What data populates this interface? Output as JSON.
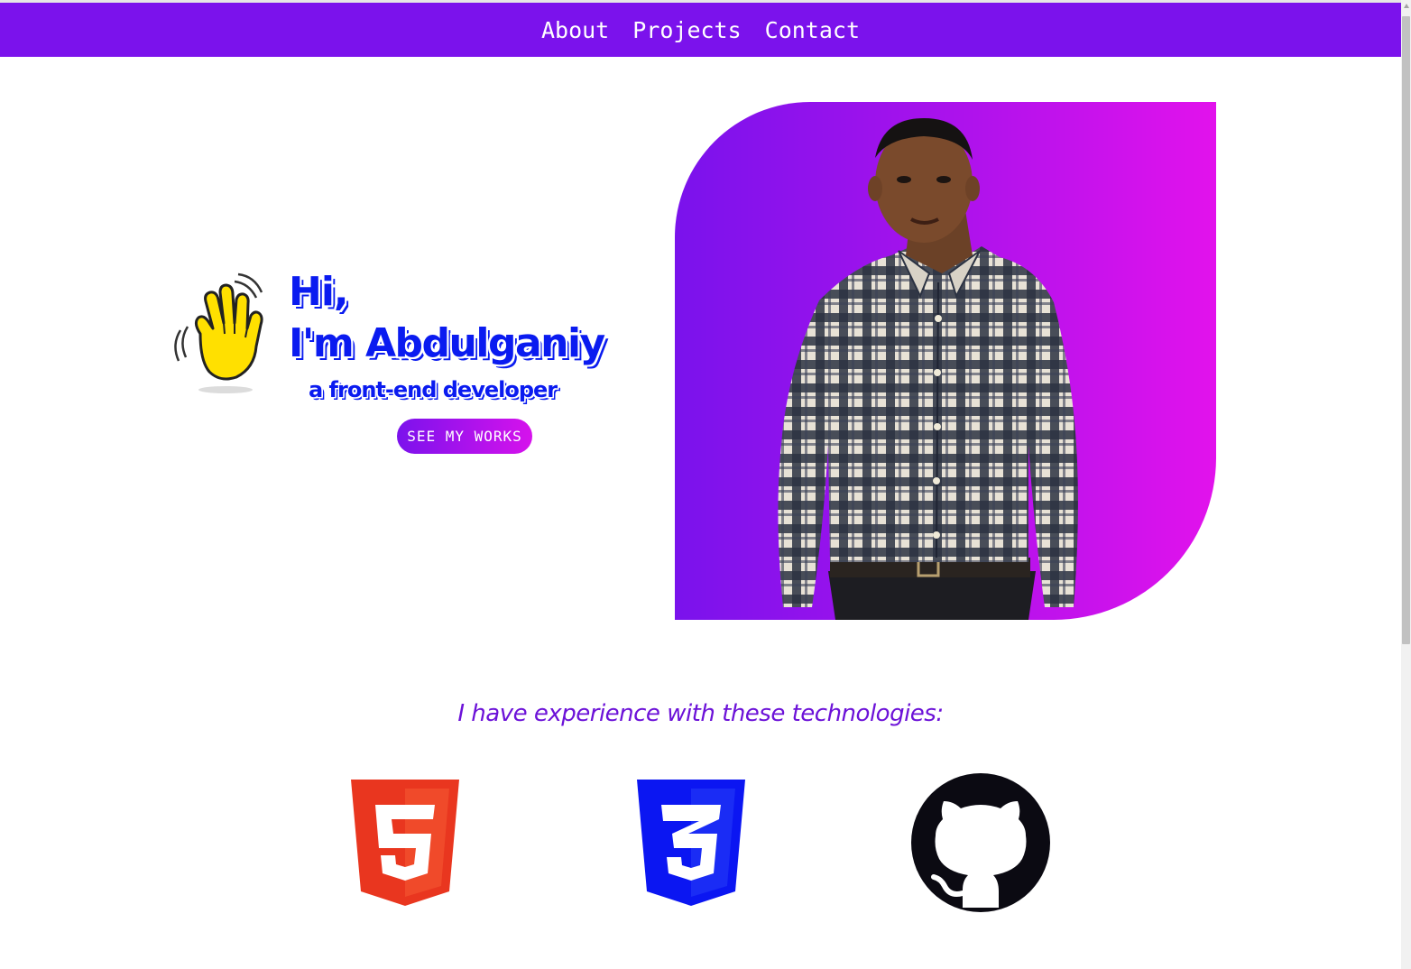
{
  "nav": {
    "items": [
      {
        "label": "About"
      },
      {
        "label": "Projects"
      },
      {
        "label": "Contact"
      }
    ]
  },
  "hero": {
    "greeting_line1": "Hi,",
    "greeting_line2": "I'm Abdulganiy",
    "role": "a front-end developer",
    "cta_label": "SEE MY WORKS",
    "wave_icon": "waving-hand-icon",
    "portrait": "portrait-photo"
  },
  "skills": {
    "heading": "I have experience with these technologies:",
    "items": [
      {
        "icon": "html5-logo-icon"
      },
      {
        "icon": "css3-logo-icon"
      },
      {
        "icon": "github-logo-icon"
      }
    ]
  },
  "colors": {
    "accent": "#7b12ec",
    "gradient_end": "#e212ec",
    "greeting_blue": "#0a1bf0",
    "heading_purple": "#6c12d8",
    "html_red": "#e9361f",
    "css_blue": "#0b16f2",
    "github_dark": "#0b0a12"
  }
}
